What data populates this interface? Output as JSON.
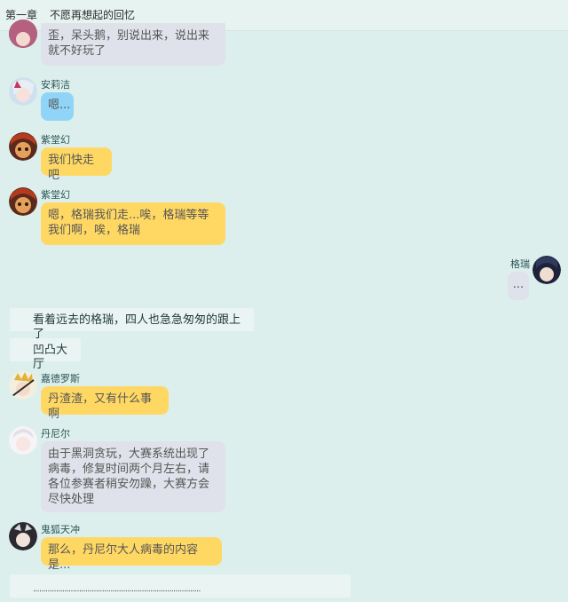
{
  "header": {
    "chapter": "第一章",
    "title": "不愿再想起的回忆"
  },
  "messages": [
    {
      "speaker": "",
      "text": "歪，呆头鹅，别说出来，说出来就不好玩了"
    },
    {
      "speaker": "安莉洁",
      "text": "嗯..."
    },
    {
      "speaker": "紫堂幻",
      "text": "我们快走吧"
    },
    {
      "speaker": "紫堂幻",
      "text": "嗯，格瑞我们走...唉，格瑞等等我们啊，唉，格瑞"
    },
    {
      "speaker": "格瑞",
      "text": "..."
    },
    {
      "narration": "看着远去的格瑞，四人也急急匆匆的跟上了"
    },
    {
      "narration": "凹凸大厅"
    },
    {
      "speaker": "嘉德罗斯",
      "text": "丹渣渣，又有什么事啊"
    },
    {
      "speaker": "丹尼尔",
      "text": "由于黑洞贪玩，大赛系统出现了病毒，修复时间两个月左右，请各位参赛者稍安勿躁，大赛方会尽快处理"
    },
    {
      "speaker": "鬼狐天冲",
      "text": "那么，丹尼尔大人病毒的内容是..."
    },
    {
      "narration": "................................................................................"
    }
  ],
  "colors": {
    "background": "#dcefed",
    "bubble_gray": "#dfe2ea",
    "bubble_blue": "#90d4f7",
    "bubble_yellow": "#ffd864"
  }
}
